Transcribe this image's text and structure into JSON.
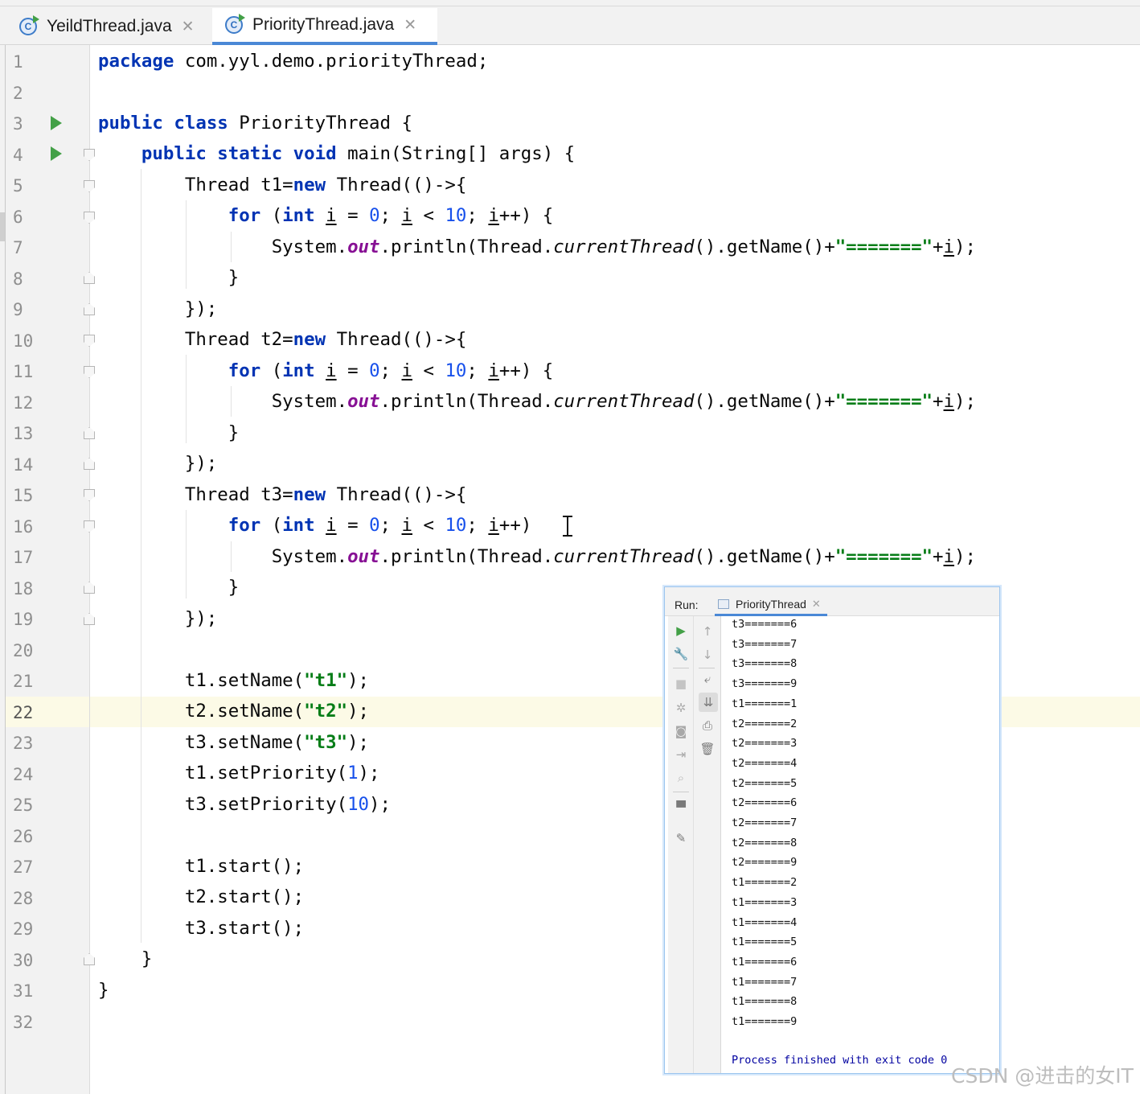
{
  "tabs": [
    {
      "label": "YeildThread.java",
      "active": false
    },
    {
      "label": "PriorityThread.java",
      "active": true
    }
  ],
  "tab_close_glyph": "✕",
  "file_icon_letter": "C",
  "editor": {
    "line_numbers": [
      "1",
      "2",
      "3",
      "4",
      "5",
      "6",
      "7",
      "8",
      "9",
      "10",
      "11",
      "12",
      "13",
      "14",
      "15",
      "16",
      "17",
      "18",
      "19",
      "20",
      "21",
      "22",
      "23",
      "24",
      "25",
      "26",
      "27",
      "28",
      "29",
      "30",
      "31",
      "32"
    ],
    "current_line": "22",
    "code": {
      "package_kw": "package",
      "package_name": " com.yyl.demo.priorityThread;",
      "public": "public",
      "class": "class",
      "class_name": " PriorityThread {",
      "static": "static",
      "void": "void",
      "main_sig": " main(String[] args) {",
      "thread_decls": [
        "Thread t1=",
        "Thread t2=",
        "Thread t3="
      ],
      "new": "new",
      "lambda_open": " Thread(()->{",
      "for": "for",
      "int": "int",
      "loop_var": "i",
      "zero": "0",
      "ten": "10",
      "sysout": "System.",
      "out": "out",
      "println": ".println(Thread.",
      "current_thread": "currentThread",
      "get_name": "().getName()+",
      "separator": "\"=======\"",
      "plus": "+",
      "print_end": ");",
      "close_brace": "}",
      "lambda_close": "});",
      "set_name_calls": [
        {
          "obj": "t1.setName(",
          "arg": "\"t1\"",
          "end": ");"
        },
        {
          "obj": "t2.setName(",
          "arg": "\"t2\"",
          "end": ");"
        },
        {
          "obj": "t3.setName(",
          "arg": "\"t3\"",
          "end": ");"
        }
      ],
      "set_priority_calls": [
        {
          "obj": "t1.setPriority(",
          "arg": "1",
          "end": ");"
        },
        {
          "obj": "t3.setPriority(",
          "arg": "10",
          "end": ");"
        }
      ],
      "start_calls": [
        "t1.start();",
        "t2.start();",
        "t3.start();"
      ]
    }
  },
  "run_panel": {
    "label": "Run:",
    "tab_name": "PriorityThread",
    "output_lines": [
      "t3=======6",
      "t3=======7",
      "t3=======8",
      "t3=======9",
      "t1=======1",
      "t2=======2",
      "t2=======3",
      "t2=======4",
      "t2=======5",
      "t2=======6",
      "t2=======7",
      "t2=======8",
      "t2=======9",
      "t1=======2",
      "t1=======3",
      "t1=======4",
      "t1=======5",
      "t1=======6",
      "t1=======7",
      "t1=======8",
      "t1=======9"
    ],
    "finish_message": "Process finished with exit code 0",
    "toolbar_icons": [
      "run-icon",
      "wrench-icon",
      "stop-icon",
      "debug-icon",
      "camera-icon",
      "exit-icon",
      "search-icon",
      "layout-icon",
      "pin-icon",
      "up-arrow-icon",
      "down-arrow-icon",
      "soft-wrap-icon",
      "scroll-to-end-icon",
      "print-icon",
      "trash-icon"
    ]
  },
  "watermark": "CSDN @进击的女IT",
  "colors": {
    "keyword": "#0033b3",
    "number": "#1750eb",
    "string": "#067d17",
    "field": "#871094",
    "run_green": "#43a047",
    "accent_blue": "#4a88d6"
  }
}
